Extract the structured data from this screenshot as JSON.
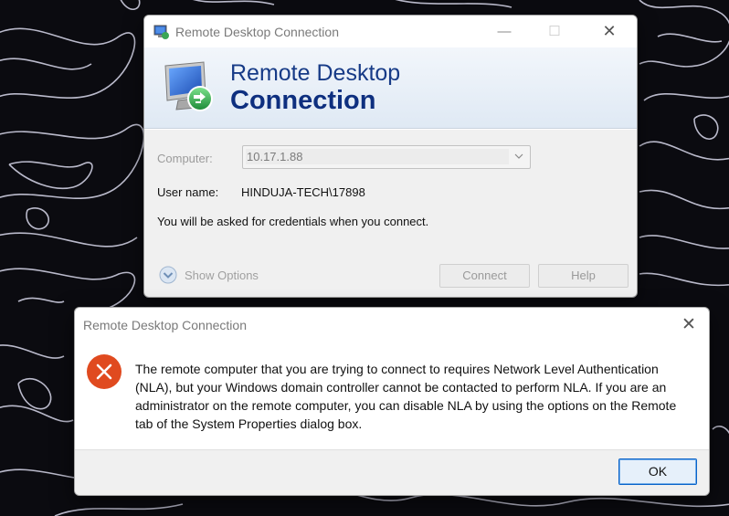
{
  "main_window": {
    "title": "Remote Desktop Connection",
    "icon": "remote-desktop-app-icon",
    "banner_line1": "Remote Desktop",
    "banner_line2": "Connection",
    "computer_label": "Computer:",
    "computer_value": "10.17.1.88",
    "username_label": "User name:",
    "username_value": "HINDUJA-TECH\\17898",
    "credentials_note": "You will be asked for credentials when you connect.",
    "show_options_label": "Show Options",
    "connect_label": "Connect",
    "help_label": "Help"
  },
  "error_dialog": {
    "title": "Remote Desktop Connection",
    "icon": "error-icon",
    "message": "The remote computer that you are trying to connect to requires Network Level Authentication (NLA), but your Windows domain controller cannot be contacted to perform NLA. If you are an administrator on the remote computer, you can disable NLA by using the options on the Remote tab of the System Properties dialog box.",
    "ok_label": "OK"
  },
  "colors": {
    "banner_text": "#0e2f7f",
    "error_red": "#e04a1f",
    "ok_border": "#0a63c9",
    "desktop_bg": "#0b0b10"
  }
}
